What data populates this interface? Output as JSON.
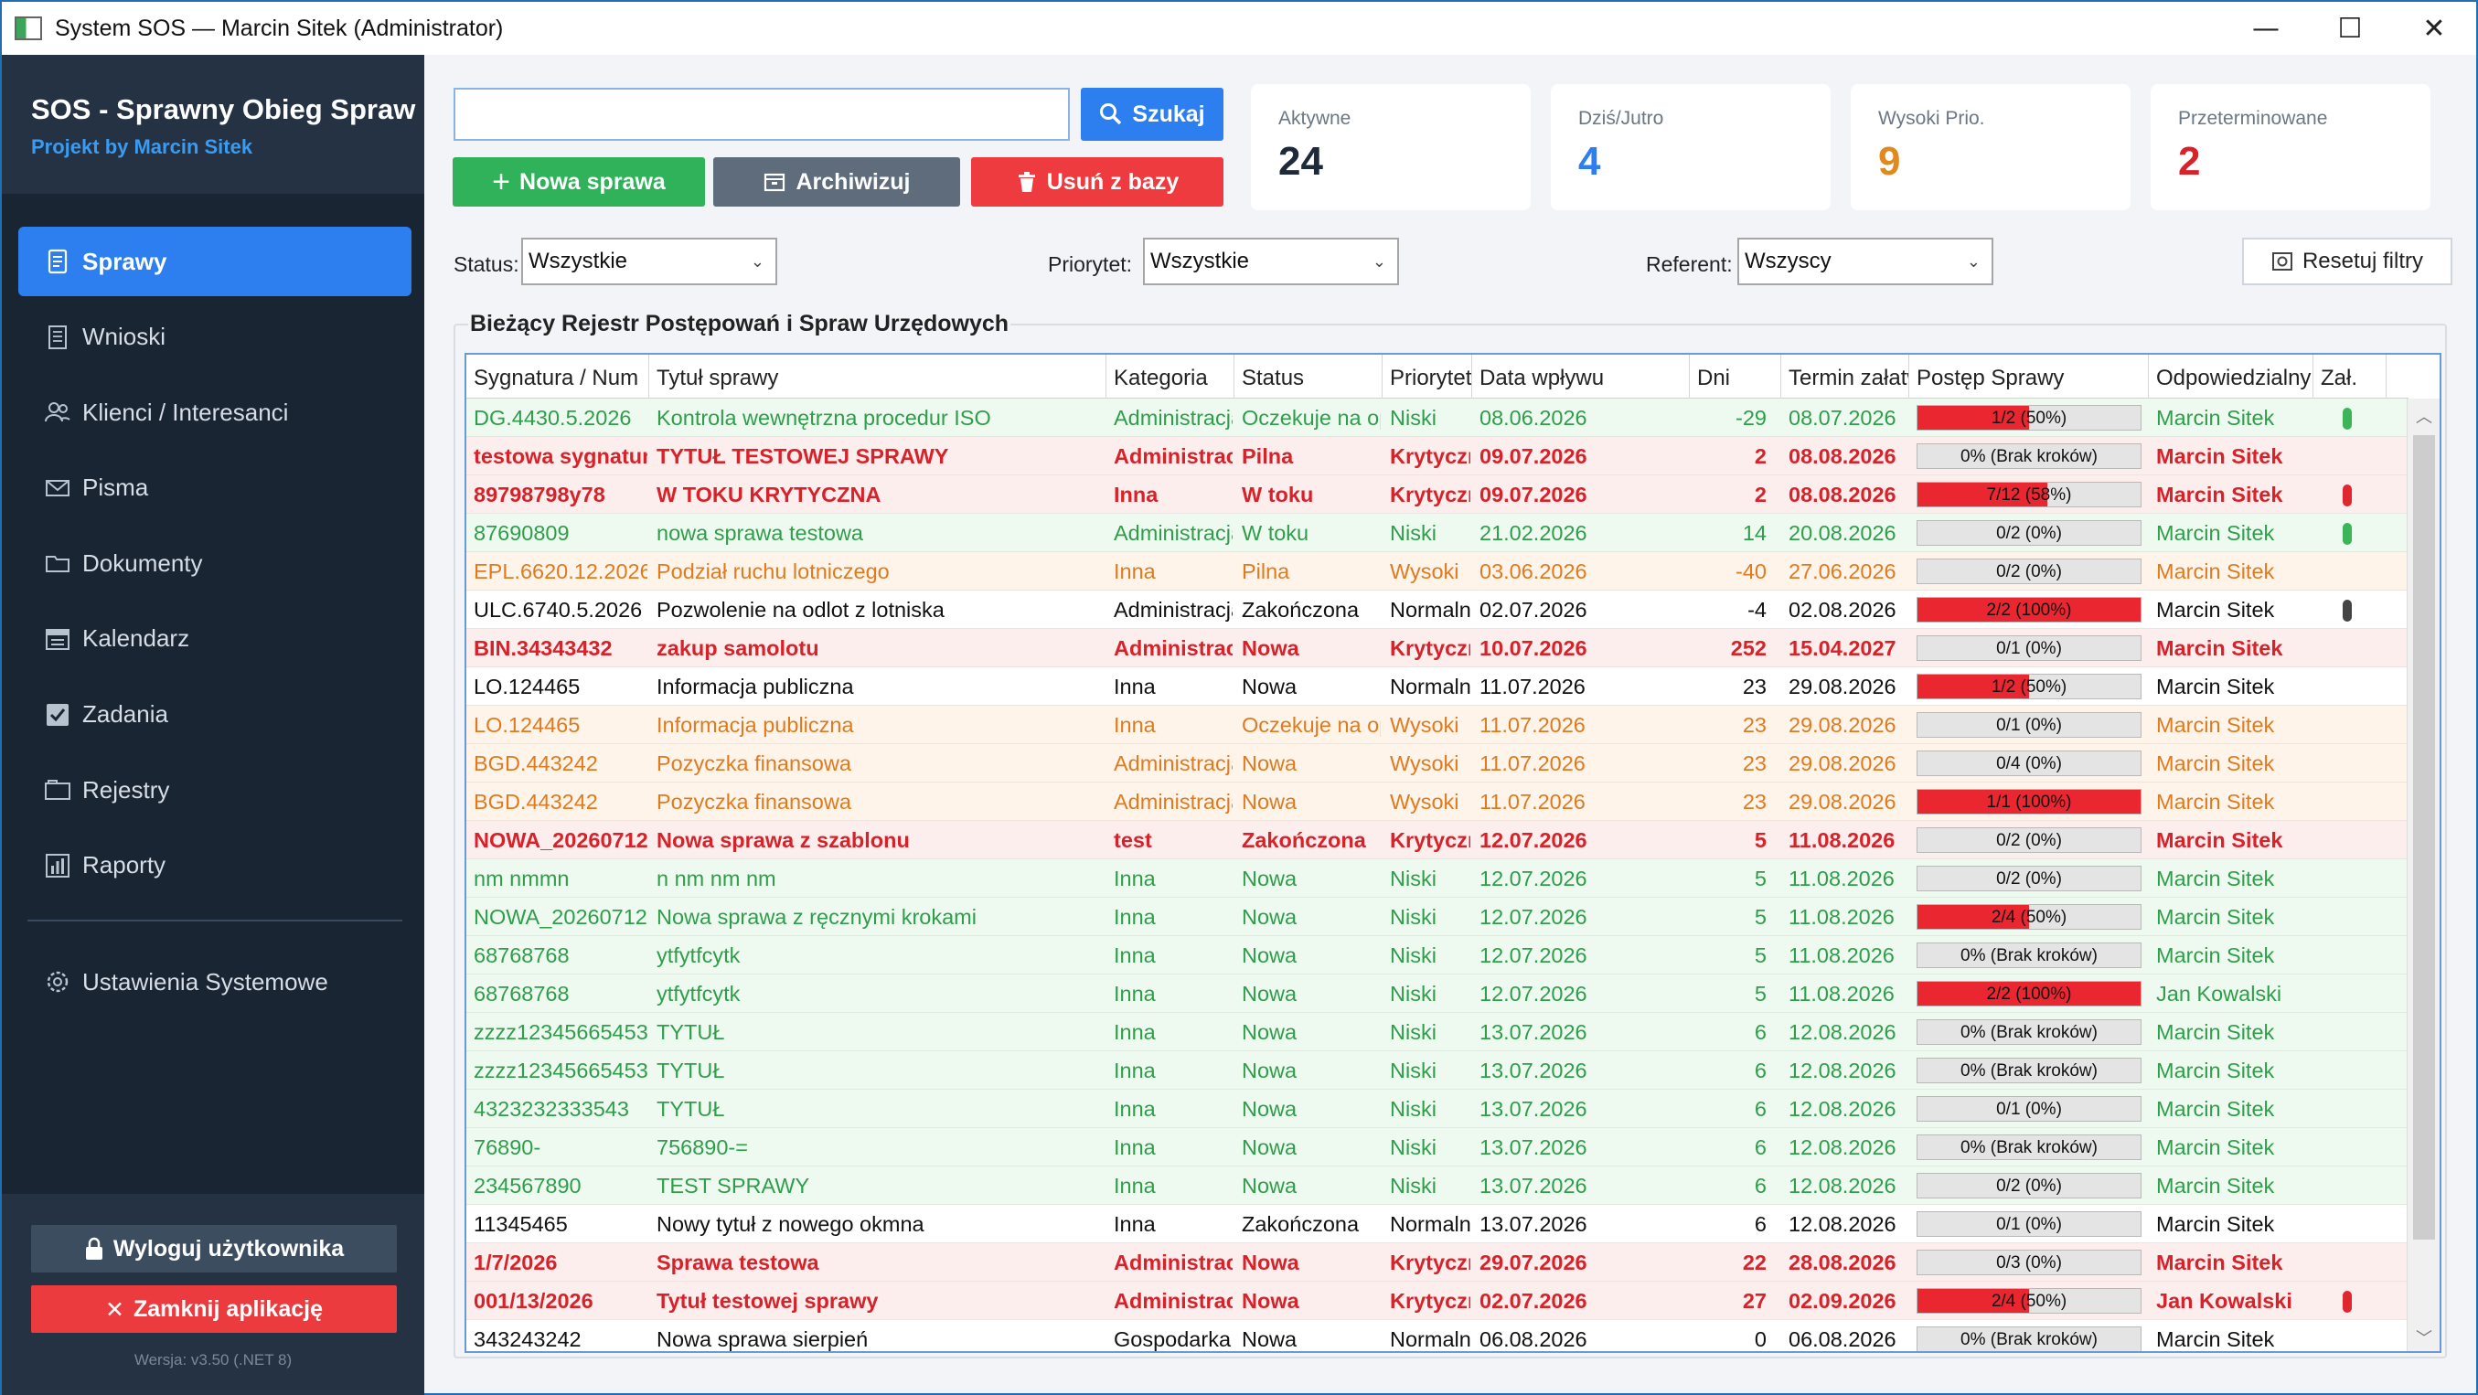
{
  "window": {
    "title": "System SOS — Marcin Sitek (Administrator)",
    "minimize": "—",
    "maximize": "☐",
    "close": "✕"
  },
  "brand": {
    "title": "SOS - Sprawny Obieg Spraw",
    "subtitle": "Projekt by Marcin Sitek"
  },
  "nav": [
    {
      "label": "Sprawy",
      "icon": "document-icon",
      "active": true
    },
    {
      "label": "Wnioski",
      "icon": "form-icon"
    },
    {
      "label": "Klienci / Interesanci",
      "icon": "users-icon"
    },
    {
      "label": "Pisma",
      "icon": "envelope-icon"
    },
    {
      "label": "Dokumenty",
      "icon": "folder-icon"
    },
    {
      "label": "Kalendarz",
      "icon": "calendar-icon"
    },
    {
      "label": "Zadania",
      "icon": "checkbox-icon"
    },
    {
      "label": "Rejestry",
      "icon": "register-icon"
    },
    {
      "label": "Raporty",
      "icon": "chart-icon"
    }
  ],
  "settings_label": "Ustawienia Systemowe",
  "logout_label": "Wyloguj użytkownika",
  "close_app_label": "Zamknij aplikację",
  "version": "Wersja: v3.50 (.NET 8)",
  "search": {
    "value": "",
    "button": "Szukaj"
  },
  "actions": {
    "new": "Nowa sprawa",
    "archive": "Archiwizuj",
    "delete": "Usuń z bazy"
  },
  "stats": [
    {
      "label": "Aktywne",
      "value": "24",
      "color": "#1e2a3a"
    },
    {
      "label": "Dziś/Jutro",
      "value": "4",
      "color": "#2d7ff0"
    },
    {
      "label": "Wysoki Prio.",
      "value": "9",
      "color": "#e08a1e"
    },
    {
      "label": "Przeterminowane",
      "value": "2",
      "color": "#d8222a"
    }
  ],
  "filters": {
    "status_label": "Status:",
    "status_value": "Wszystkie",
    "priority_label": "Priorytet:",
    "priority_value": "Wszystkie",
    "referent_label": "Referent:",
    "referent_value": "Wszyscy",
    "reset": "Resetuj filtry"
  },
  "group_title": "Bieżący Rejestr Postępowań i Spraw Urzędowych",
  "columns": [
    "Sygnatura / Num",
    "Tytuł sprawy",
    "Kategoria",
    "Status",
    "Priorytet",
    "Data wpływu",
    "Dni",
    "Termin załatwienia",
    "Postęp Sprawy",
    "Odpowiedzialny",
    "Zał."
  ],
  "rows": [
    {
      "sig": "DG.4430.5.2026",
      "title": "Kontrola wewnętrzna procedur ISO",
      "cat": "Administracja",
      "status": "Oczekuje na opinię",
      "prio": "Niski",
      "date": "08.06.2026",
      "days": "-29",
      "term": "08.07.2026",
      "progress": 0.5,
      "ptext": "1/2 (50%)",
      "owner": "Marcin Sitek",
      "clip": "#3cb55a",
      "style": "green",
      "bg": "#eefaf0"
    },
    {
      "sig": "testowa sygnatura",
      "title": "TYTUŁ TESTOWEJ SPRAWY",
      "cat": "Administracja",
      "status": "Pilna",
      "prio": "Krytyczny",
      "date": "09.07.2026",
      "days": "2",
      "term": "08.08.2026",
      "progress": 0,
      "ptext": "0% (Brak kroków)",
      "owner": "Marcin Sitek",
      "clip": "",
      "style": "red",
      "bg": "#fdeeee"
    },
    {
      "sig": "89798798y78",
      "title": "W TOKU KRYTYCZNA",
      "cat": "Inna",
      "status": "W toku",
      "prio": "Krytyczny",
      "date": "09.07.2026",
      "days": "2",
      "term": "08.08.2026",
      "progress": 0.58,
      "ptext": "7/12 (58%)",
      "owner": "Marcin Sitek",
      "clip": "#e0262e",
      "style": "red",
      "bg": "#fdeeee"
    },
    {
      "sig": "87690809",
      "title": "nowa sprawa testowa",
      "cat": "Administracja",
      "status": "W toku",
      "prio": "Niski",
      "date": "21.02.2026",
      "days": "14",
      "term": "20.08.2026",
      "progress": 0,
      "ptext": "0/2 (0%)",
      "owner": "Marcin Sitek",
      "clip": "#3cb55a",
      "style": "green",
      "bg": "#eefaf0"
    },
    {
      "sig": "EPL.6620.12.2026",
      "title": "Podział ruchu lotniczego",
      "cat": "Inna",
      "status": "Pilna",
      "prio": "Wysoki",
      "date": "03.06.2026",
      "days": "-40",
      "term": "27.06.2026",
      "progress": 0,
      "ptext": "0/2 (0%)",
      "owner": "Marcin Sitek",
      "clip": "",
      "style": "orange",
      "bg": "#fff4ea"
    },
    {
      "sig": "ULC.6740.5.2026",
      "title": "Pozwolenie na odlot z lotniska",
      "cat": "Administracja",
      "status": "Zakończona",
      "prio": "Normalny",
      "date": "02.07.2026",
      "days": "-4",
      "term": "02.08.2026",
      "progress": 1,
      "ptext": "2/2 (100%)",
      "owner": "Marcin Sitek",
      "clip": "#444444",
      "style": "black",
      "bg": "#ffffff"
    },
    {
      "sig": "BIN.34343432",
      "title": "zakup samolotu",
      "cat": "Administracja",
      "status": "Nowa",
      "prio": "Krytyczny",
      "date": "10.07.2026",
      "days": "252",
      "term": "15.04.2027",
      "progress": 0,
      "ptext": "0/1 (0%)",
      "owner": "Marcin Sitek",
      "clip": "",
      "style": "red",
      "bg": "#fdeeee"
    },
    {
      "sig": "LO.124465",
      "title": "Informacja publiczna",
      "cat": "Inna",
      "status": "Nowa",
      "prio": "Normalny",
      "date": "11.07.2026",
      "days": "23",
      "term": "29.08.2026",
      "progress": 0.5,
      "ptext": "1/2 (50%)",
      "owner": "Marcin Sitek",
      "clip": "",
      "style": "black",
      "bg": "#ffffff"
    },
    {
      "sig": "LO.124465",
      "title": "Informacja publiczna",
      "cat": "Inna",
      "status": "Oczekuje na opinię",
      "prio": "Wysoki",
      "date": "11.07.2026",
      "days": "23",
      "term": "29.08.2026",
      "progress": 0,
      "ptext": "0/1 (0%)",
      "owner": "Marcin Sitek",
      "clip": "",
      "style": "orange",
      "bg": "#fff4ea"
    },
    {
      "sig": "BGD.443242",
      "title": "Pozyczka finansowa",
      "cat": "Administracja",
      "status": "Nowa",
      "prio": "Wysoki",
      "date": "11.07.2026",
      "days": "23",
      "term": "29.08.2026",
      "progress": 0,
      "ptext": "0/4 (0%)",
      "owner": "Marcin Sitek",
      "clip": "",
      "style": "orange",
      "bg": "#fff4ea"
    },
    {
      "sig": "BGD.443242",
      "title": "Pozyczka finansowa",
      "cat": "Administracja",
      "status": "Nowa",
      "prio": "Wysoki",
      "date": "11.07.2026",
      "days": "23",
      "term": "29.08.2026",
      "progress": 1,
      "ptext": "1/1 (100%)",
      "owner": "Marcin Sitek",
      "clip": "",
      "style": "orange",
      "bg": "#fff4ea"
    },
    {
      "sig": "NOWA_20260712",
      "title": "Nowa sprawa z szablonu",
      "cat": "test",
      "status": "Zakończona",
      "prio": "Krytyczny",
      "date": "12.07.2026",
      "days": "5",
      "term": "11.08.2026",
      "progress": 0,
      "ptext": "0/2 (0%)",
      "owner": "Marcin Sitek",
      "clip": "",
      "style": "red",
      "bg": "#fdeeee"
    },
    {
      "sig": "nm nmmn",
      "title": "n nm nm nm",
      "cat": "Inna",
      "status": "Nowa",
      "prio": "Niski",
      "date": "12.07.2026",
      "days": "5",
      "term": "11.08.2026",
      "progress": 0,
      "ptext": "0/2 (0%)",
      "owner": "Marcin Sitek",
      "clip": "",
      "style": "green",
      "bg": "#eefaf0"
    },
    {
      "sig": "NOWA_20260712",
      "title": "Nowa sprawa z ręcznymi krokami",
      "cat": "Inna",
      "status": "Nowa",
      "prio": "Niski",
      "date": "12.07.2026",
      "days": "5",
      "term": "11.08.2026",
      "progress": 0.5,
      "ptext": "2/4 (50%)",
      "owner": "Marcin Sitek",
      "clip": "",
      "style": "green",
      "bg": "#eefaf0"
    },
    {
      "sig": "68768768",
      "title": "ytfytfcytk",
      "cat": "Inna",
      "status": "Nowa",
      "prio": "Niski",
      "date": "12.07.2026",
      "days": "5",
      "term": "11.08.2026",
      "progress": 0,
      "ptext": "0% (Brak kroków)",
      "owner": "Marcin Sitek",
      "clip": "",
      "style": "green",
      "bg": "#eefaf0"
    },
    {
      "sig": "68768768",
      "title": "ytfytfcytk",
      "cat": "Inna",
      "status": "Nowa",
      "prio": "Niski",
      "date": "12.07.2026",
      "days": "5",
      "term": "11.08.2026",
      "progress": 1,
      "ptext": "2/2 (100%)",
      "owner": "Jan Kowalski",
      "clip": "",
      "style": "green",
      "bg": "#eefaf0"
    },
    {
      "sig": "zzzz12345665453",
      "title": "TYTUŁ",
      "cat": "Inna",
      "status": "Nowa",
      "prio": "Niski",
      "date": "13.07.2026",
      "days": "6",
      "term": "12.08.2026",
      "progress": 0,
      "ptext": "0% (Brak kroków)",
      "owner": "Marcin Sitek",
      "clip": "",
      "style": "green",
      "bg": "#eefaf0"
    },
    {
      "sig": "zzzz12345665453",
      "title": "TYTUŁ",
      "cat": "Inna",
      "status": "Nowa",
      "prio": "Niski",
      "date": "13.07.2026",
      "days": "6",
      "term": "12.08.2026",
      "progress": 0,
      "ptext": "0% (Brak kroków)",
      "owner": "Marcin Sitek",
      "clip": "",
      "style": "green",
      "bg": "#eefaf0"
    },
    {
      "sig": "4323232333543",
      "title": "TYTUŁ",
      "cat": "Inna",
      "status": "Nowa",
      "prio": "Niski",
      "date": "13.07.2026",
      "days": "6",
      "term": "12.08.2026",
      "progress": 0,
      "ptext": "0/1 (0%)",
      "owner": "Marcin Sitek",
      "clip": "",
      "style": "green",
      "bg": "#eefaf0"
    },
    {
      "sig": "76890-",
      "title": "756890-=",
      "cat": "Inna",
      "status": "Nowa",
      "prio": "Niski",
      "date": "13.07.2026",
      "days": "6",
      "term": "12.08.2026",
      "progress": 0,
      "ptext": "0% (Brak kroków)",
      "owner": "Marcin Sitek",
      "clip": "",
      "style": "green",
      "bg": "#eefaf0"
    },
    {
      "sig": "234567890",
      "title": "TEST SPRAWY",
      "cat": "Inna",
      "status": "Nowa",
      "prio": "Niski",
      "date": "13.07.2026",
      "days": "6",
      "term": "12.08.2026",
      "progress": 0,
      "ptext": "0/2 (0%)",
      "owner": "Marcin Sitek",
      "clip": "",
      "style": "green",
      "bg": "#eefaf0"
    },
    {
      "sig": "11345465",
      "title": "Nowy tytuł z nowego okmna",
      "cat": "Inna",
      "status": "Zakończona",
      "prio": "Normalny",
      "date": "13.07.2026",
      "days": "6",
      "term": "12.08.2026",
      "progress": 0,
      "ptext": "0/1 (0%)",
      "owner": "Marcin Sitek",
      "clip": "",
      "style": "black",
      "bg": "#ffffff"
    },
    {
      "sig": "1/7/2026",
      "title": "Sprawa testowa",
      "cat": "Administracja",
      "status": "Nowa",
      "prio": "Krytyczny",
      "date": "29.07.2026",
      "days": "22",
      "term": "28.08.2026",
      "progress": 0,
      "ptext": "0/3 (0%)",
      "owner": "Marcin Sitek",
      "clip": "",
      "style": "red",
      "bg": "#fdeeee"
    },
    {
      "sig": "001/13/2026",
      "title": "Tytuł testowej sprawy",
      "cat": "Administracja",
      "status": "Nowa",
      "prio": "Krytyczny",
      "date": "02.07.2026",
      "days": "27",
      "term": "02.09.2026",
      "progress": 0.5,
      "ptext": "2/4 (50%)",
      "owner": "Jan Kowalski",
      "clip": "#e0262e",
      "style": "red",
      "bg": "#fdeeee"
    },
    {
      "sig": "343243242",
      "title": "Nowa sprawa sierpień",
      "cat": "Gospodarka",
      "status": "Nowa",
      "prio": "Normalny",
      "date": "06.08.2026",
      "days": "0",
      "term": "06.08.2026",
      "progress": 0,
      "ptext": "0% (Brak kroków)",
      "owner": "Marcin Sitek",
      "clip": "",
      "style": "black",
      "bg": "#ffffff"
    }
  ]
}
